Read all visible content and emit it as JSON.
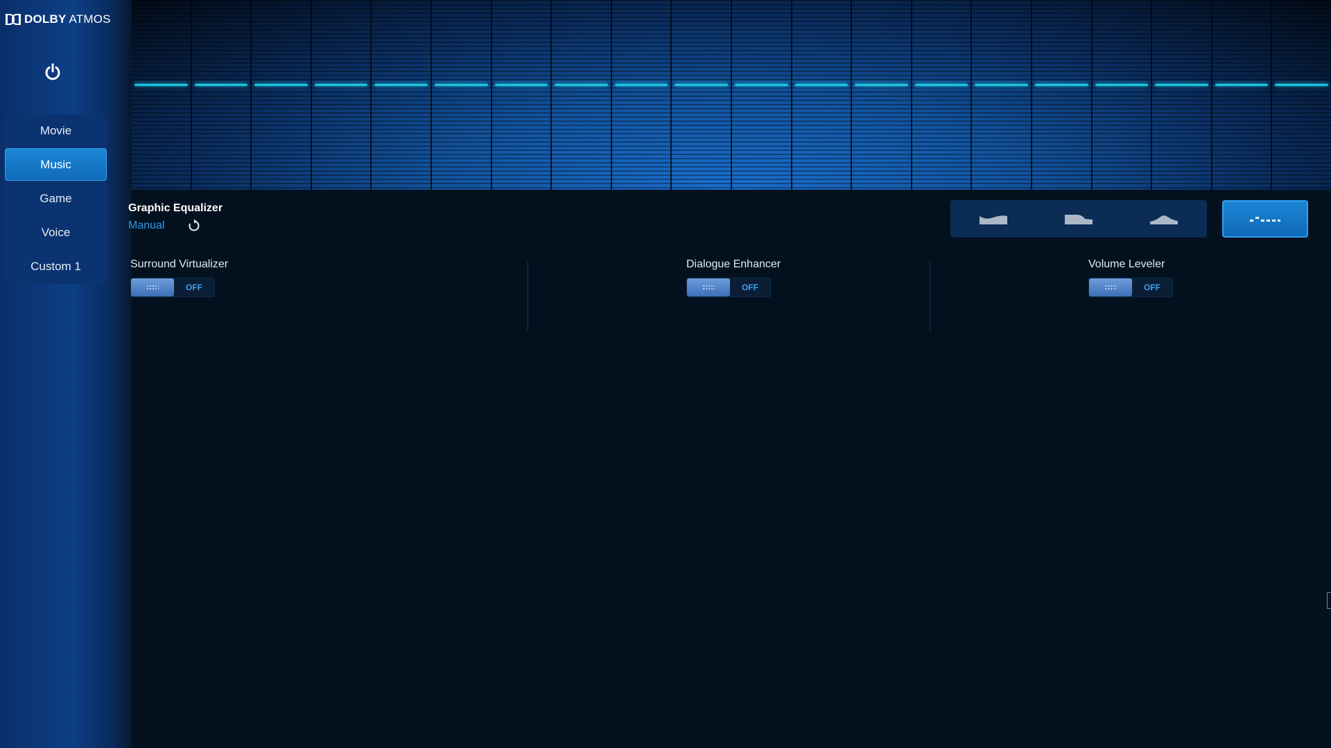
{
  "brand": {
    "bold": "DOLBY",
    "regular": " ATMOS"
  },
  "sidebar": {
    "items": [
      {
        "label": "Movie",
        "active": false
      },
      {
        "label": "Music",
        "active": true
      },
      {
        "label": "Game",
        "active": false
      },
      {
        "label": "Voice",
        "active": false
      },
      {
        "label": "Custom 1",
        "active": false
      }
    ]
  },
  "equalizer": {
    "title": "Graphic Equalizer",
    "mode": "Manual",
    "band_count": 20,
    "band_levels": [
      0.44,
      0.44,
      0.44,
      0.44,
      0.44,
      0.44,
      0.44,
      0.44,
      0.44,
      0.44,
      0.44,
      0.44,
      0.44,
      0.44,
      0.44,
      0.44,
      0.44,
      0.44,
      0.44,
      0.44
    ],
    "level_color": "#1ec7e0"
  },
  "presets": [
    "open-preset-icon",
    "rich-preset-icon",
    "focused-preset-icon",
    "manual-preset-icon"
  ],
  "features": [
    {
      "label": "Surround Virtualizer",
      "state": "OFF"
    },
    {
      "label": "Dialogue Enhancer",
      "state": "OFF"
    },
    {
      "label": "Volume Leveler",
      "state": "OFF"
    }
  ],
  "colors": {
    "accent": "#2d9be6",
    "active_tab": "#1577c8",
    "background": "#03111f"
  }
}
